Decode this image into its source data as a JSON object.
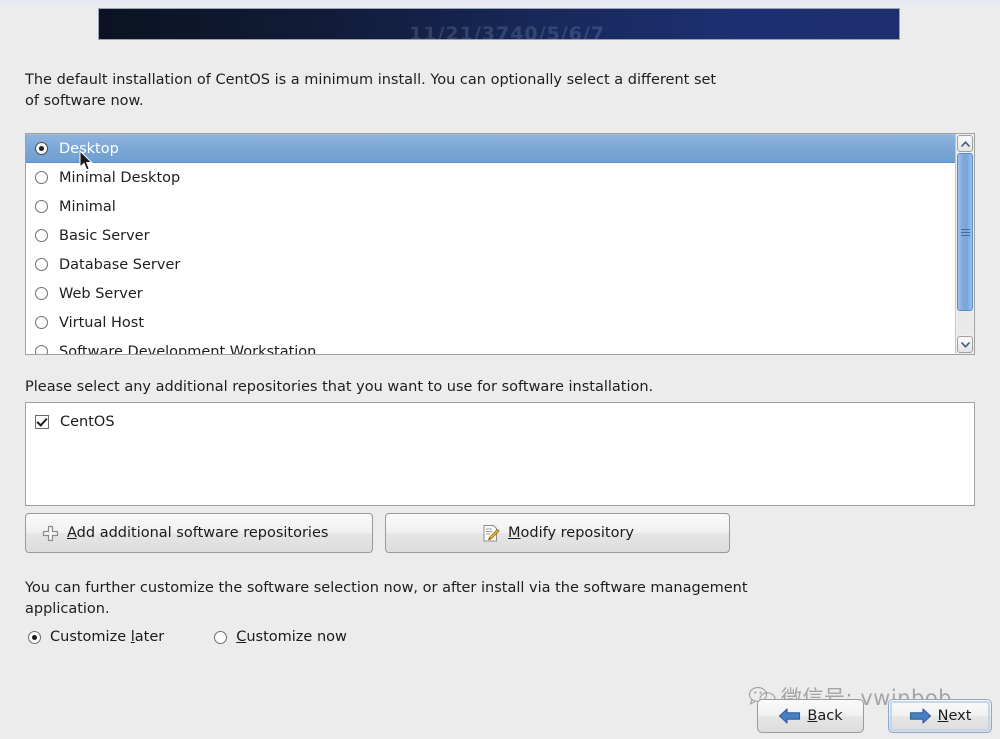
{
  "banner": {
    "watermark_text": "11/21/3740/5/6/7"
  },
  "intro": {
    "text": "The default installation of CentOS is a minimum install. You can optionally select a different set of software now."
  },
  "software_list": {
    "selected_index": 0,
    "items": [
      {
        "label": "Desktop",
        "selected": true
      },
      {
        "label": "Minimal Desktop",
        "selected": false
      },
      {
        "label": "Minimal",
        "selected": false
      },
      {
        "label": "Basic Server",
        "selected": false
      },
      {
        "label": "Database Server",
        "selected": false
      },
      {
        "label": "Web Server",
        "selected": false
      },
      {
        "label": "Virtual Host",
        "selected": false
      },
      {
        "label": "Software Development Workstation",
        "selected": false
      }
    ],
    "scrollbar": {
      "up_arrow_icon": "chevron-up-icon",
      "down_arrow_icon": "chevron-down-icon",
      "thumb_grip_icon": "grip-lines-icon"
    }
  },
  "repositories": {
    "label": "Please select any additional repositories that you want to use for software installation.",
    "items": [
      {
        "label": "CentOS",
        "checked": true
      }
    ],
    "add_button": {
      "icon": "plus-icon",
      "mnemonic": "A",
      "label_rest": "dd additional software repositories",
      "full_label": "Add additional software repositories"
    },
    "modify_button": {
      "icon": "document-pencil-icon",
      "mnemonic": "M",
      "label_rest": "odify repository",
      "full_label": "Modify repository"
    }
  },
  "customize": {
    "text": "You can further customize the software selection now, or after install via the software management application.",
    "options": [
      {
        "label_pre": "Customize ",
        "mnemonic": "l",
        "label_post": "ater",
        "full_label": "Customize later",
        "selected": true
      },
      {
        "label_pre": "",
        "mnemonic": "C",
        "label_post": "ustomize now",
        "full_label": "Customize now",
        "selected": false
      }
    ]
  },
  "navigation": {
    "back": {
      "icon": "arrow-left-icon",
      "mnemonic": "B",
      "label_rest": "ack",
      "full_label": "Back"
    },
    "next": {
      "icon": "arrow-right-icon",
      "mnemonic": "N",
      "label_rest": "ext",
      "full_label": "Next"
    }
  },
  "watermark": {
    "icon": "wechat-icon",
    "text": "微信号: vwinbob"
  },
  "colors": {
    "page_background": "#ececec",
    "banner_dark": "#0b1222",
    "banner_blue": "#1e2f70",
    "selection_blue": "#7ba7d6",
    "accent_arrow_blue": "#2f6cb5"
  }
}
